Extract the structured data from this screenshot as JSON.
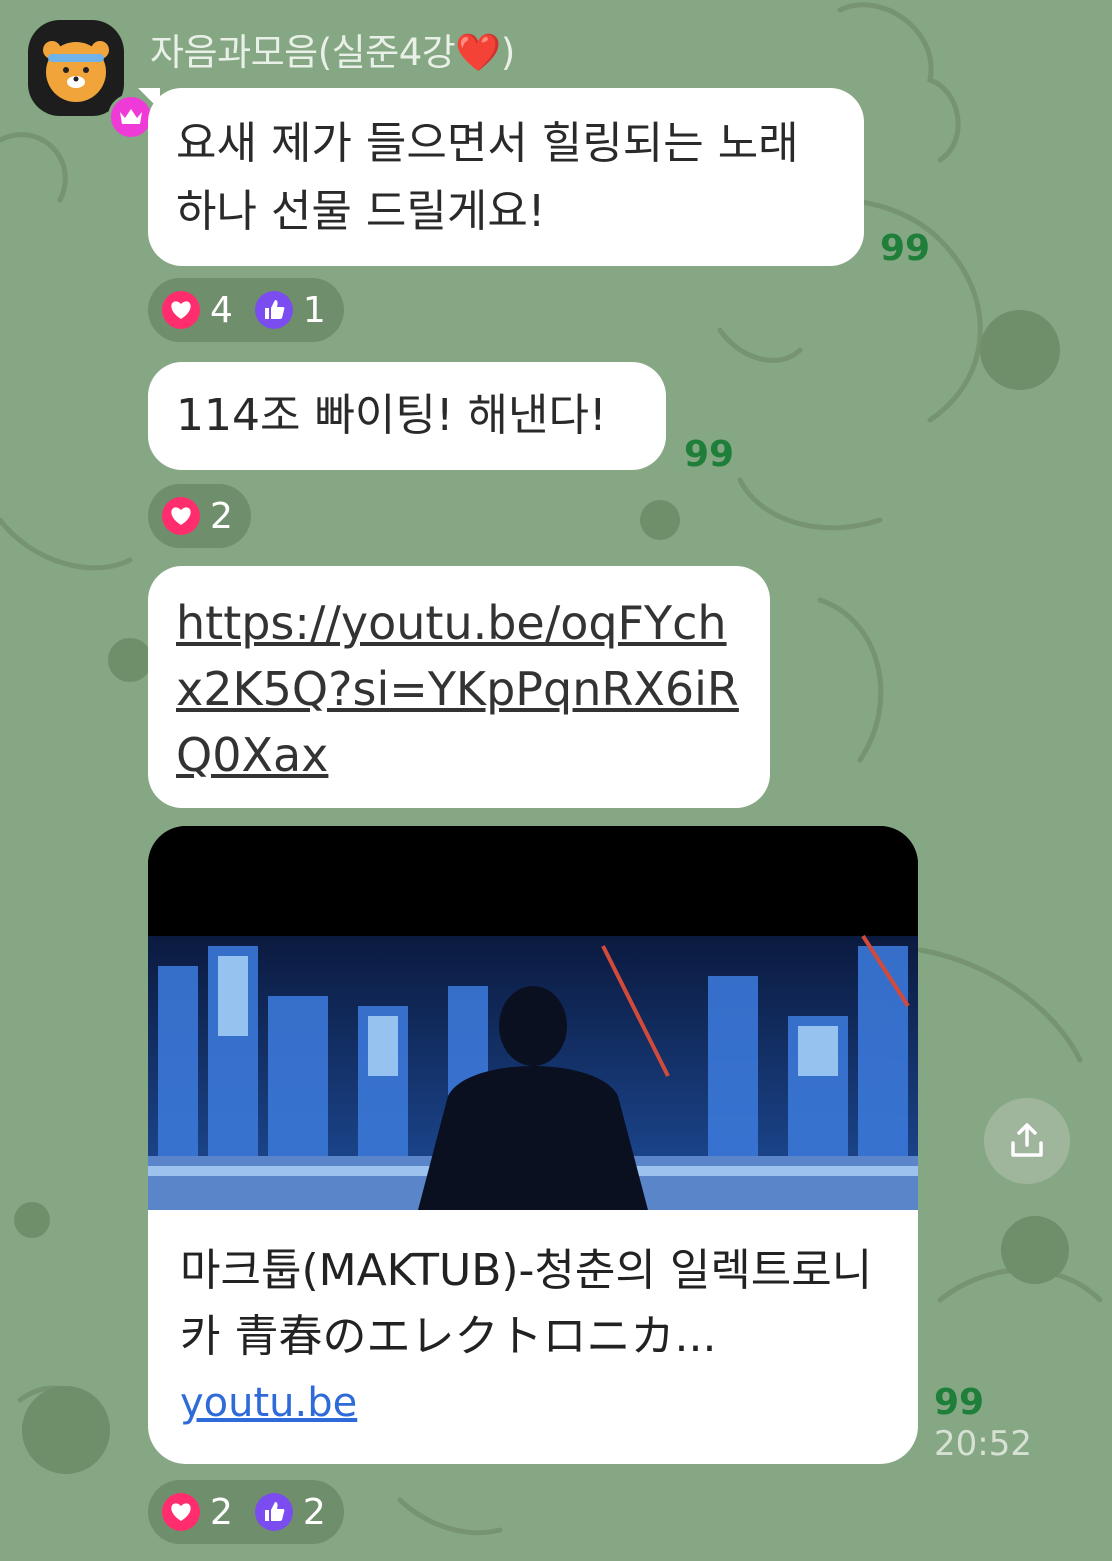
{
  "sender": {
    "name": "자음과모음(실준4강",
    "heart": "❤️",
    "close": ")"
  },
  "messages": [
    {
      "text": "요새 제가 들으면서 힐링되는 노래 하나 선물 드릴게요!",
      "unread": "99"
    },
    {
      "text": "114조 빠이팅! 해낸다!",
      "unread": "99"
    },
    {
      "text": "https://youtu.be/oqFYchx2K5Q?si=YKpPqnRX6iRQ0Xax"
    }
  ],
  "reactions": [
    {
      "heart": "4",
      "like": "1"
    },
    {
      "heart": "2"
    },
    {
      "heart": "2",
      "like": "2"
    }
  ],
  "link_preview": {
    "title": "마크툽(MAKTUB)-청춘의 일렉트로니카 青春のエレクトロニカ...",
    "domain": "youtu.be",
    "unread": "99",
    "time": "20:52"
  },
  "colors": {
    "background": "#86a783",
    "unread": "#1f7f3a",
    "heart": "#ff2d6d",
    "like": "#7b4cf0",
    "link": "#2f6bd8"
  },
  "icons": {
    "avatar": "ryan-character-icon",
    "badge": "crown-icon",
    "share": "share-icon"
  }
}
